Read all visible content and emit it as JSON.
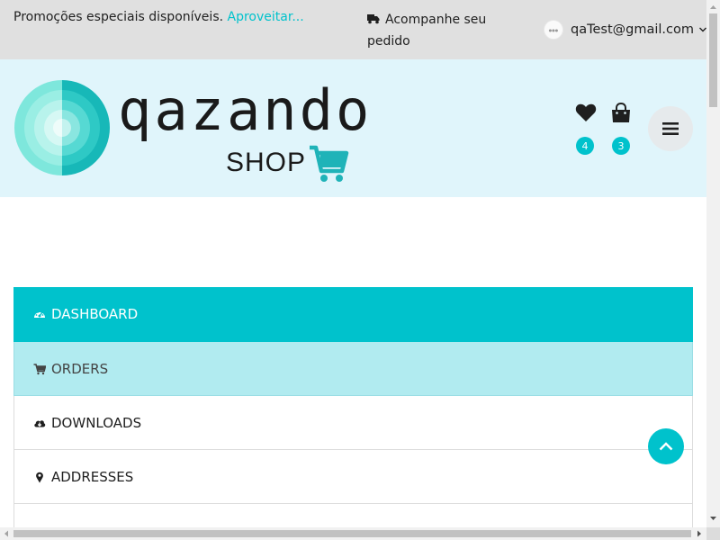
{
  "topbar": {
    "promo_text": "Promoções especiais disponíveis.",
    "promo_link": "Aproveitar...",
    "track_order": "Acompanhe seu pedido",
    "account_email": "qaTest@gmail.com"
  },
  "header": {
    "logo_brand": "qazando",
    "logo_sub": "SHOP",
    "wishlist_count": "4",
    "cart_count": "3"
  },
  "account_nav": {
    "items": [
      {
        "label": "DASHBOARD",
        "icon": "dashboard-icon",
        "state": "active"
      },
      {
        "label": "ORDERS",
        "icon": "cart-icon",
        "state": "hover"
      },
      {
        "label": "DOWNLOADS",
        "icon": "cloud-download-icon",
        "state": "normal"
      },
      {
        "label": "ADDRESSES",
        "icon": "map-marker-icon",
        "state": "normal"
      }
    ]
  },
  "colors": {
    "accent": "#00c2cc",
    "topbar_bg": "#e0e0e0",
    "header_bg": "#e0f5fb",
    "hover_bg": "#b1ebf0"
  }
}
